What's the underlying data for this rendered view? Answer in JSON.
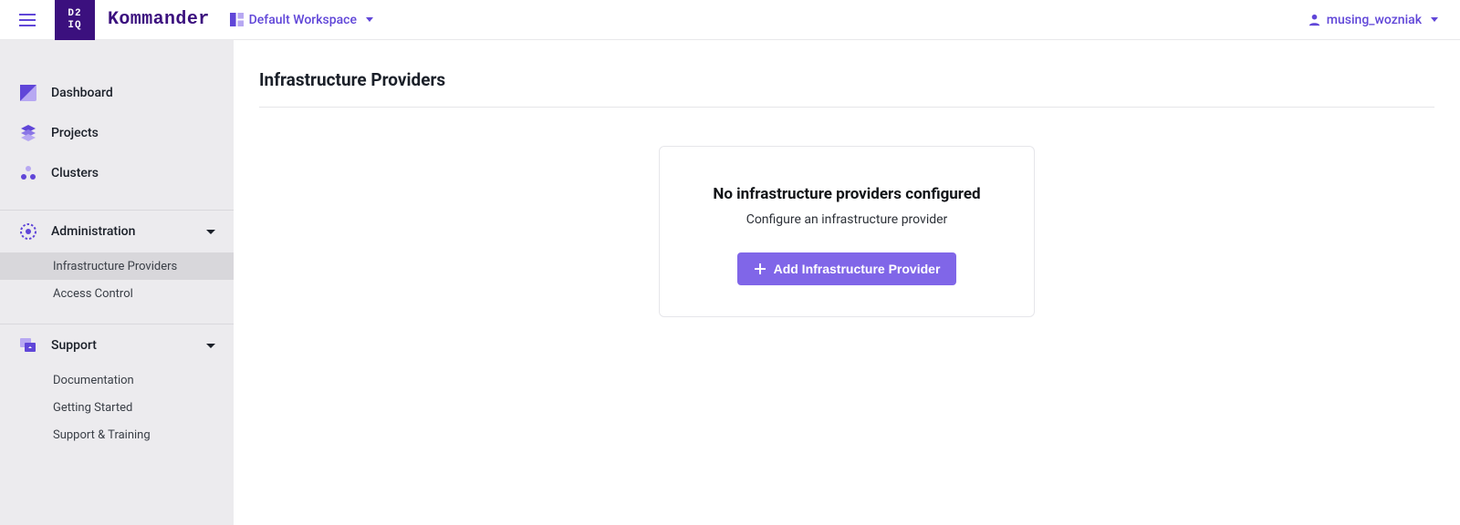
{
  "colors": {
    "brand_dark": "#3b107e",
    "accent": "#6046d8",
    "accent_light": "#8066e8",
    "sidebar_bg": "#ecebee"
  },
  "header": {
    "logo_line1": "D2",
    "logo_line2": "IQ",
    "brand": "Kommander",
    "workspace_label": "Default Workspace",
    "user_label": "musing_wozniak"
  },
  "sidebar": {
    "primary": [
      {
        "label": "Dashboard",
        "icon": "dashboard"
      },
      {
        "label": "Projects",
        "icon": "projects"
      },
      {
        "label": "Clusters",
        "icon": "clusters"
      }
    ],
    "sections": [
      {
        "label": "Administration",
        "icon": "gear",
        "expanded": true,
        "items": [
          {
            "label": "Infrastructure Providers",
            "active": true
          },
          {
            "label": "Access Control",
            "active": false
          }
        ]
      },
      {
        "label": "Support",
        "icon": "support",
        "expanded": true,
        "items": [
          {
            "label": "Documentation",
            "active": false
          },
          {
            "label": "Getting Started",
            "active": false
          },
          {
            "label": "Support & Training",
            "active": false
          }
        ]
      }
    ]
  },
  "page": {
    "title": "Infrastructure Providers",
    "empty_state": {
      "title": "No infrastructure providers configured",
      "subtitle": "Configure an infrastructure provider",
      "button_label": "Add Infrastructure Provider"
    }
  }
}
